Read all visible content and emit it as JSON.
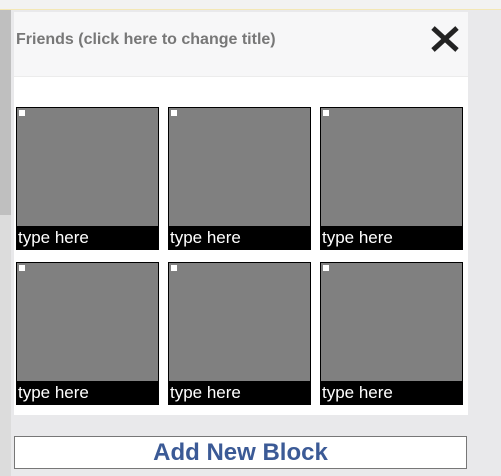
{
  "panel": {
    "title": "Friends (click here to change title)",
    "close_icon": "close-icon"
  },
  "grid": {
    "tiles": [
      {
        "caption": "type here"
      },
      {
        "caption": "type here"
      },
      {
        "caption": "type here"
      },
      {
        "caption": "type here"
      },
      {
        "caption": "type here"
      },
      {
        "caption": "type here"
      }
    ]
  },
  "actions": {
    "add_block_label": "Add New Block"
  },
  "colors": {
    "tile_fill": "#808080",
    "caption_bg": "#000000",
    "add_block_text": "#3b5a96"
  }
}
